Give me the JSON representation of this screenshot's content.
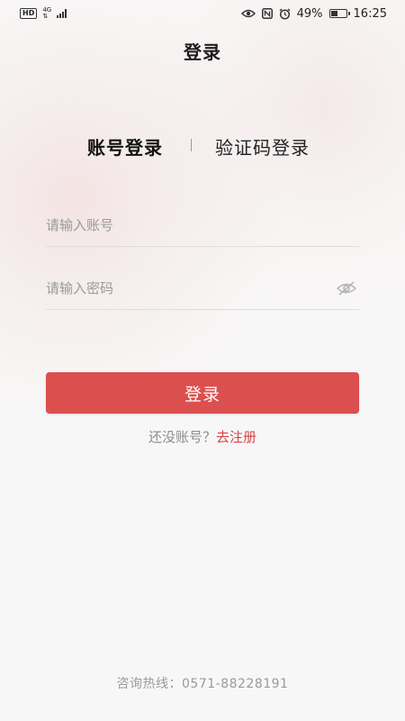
{
  "status_bar": {
    "hd_badge": "HD",
    "network": "4G",
    "battery_percent": "49%",
    "battery_level": 0.49,
    "time": "16:25"
  },
  "nav": {
    "title": "登录"
  },
  "tabs": [
    {
      "label": "账号登录",
      "active": true
    },
    {
      "label": "验证码登录",
      "active": false
    }
  ],
  "form": {
    "account_placeholder": "请输入账号",
    "password_placeholder": "请输入密码",
    "login_button": "登录"
  },
  "register": {
    "prompt": "还没账号？",
    "link": "去注册"
  },
  "footer": {
    "hotline": "咨询热线：0571-88228191"
  },
  "colors": {
    "accent": "#dc4f4f",
    "link": "#d64545"
  },
  "icons": [
    "eye-off-icon",
    "nfc-icon",
    "alarm-icon",
    "battery-icon",
    "signal-icon"
  ]
}
